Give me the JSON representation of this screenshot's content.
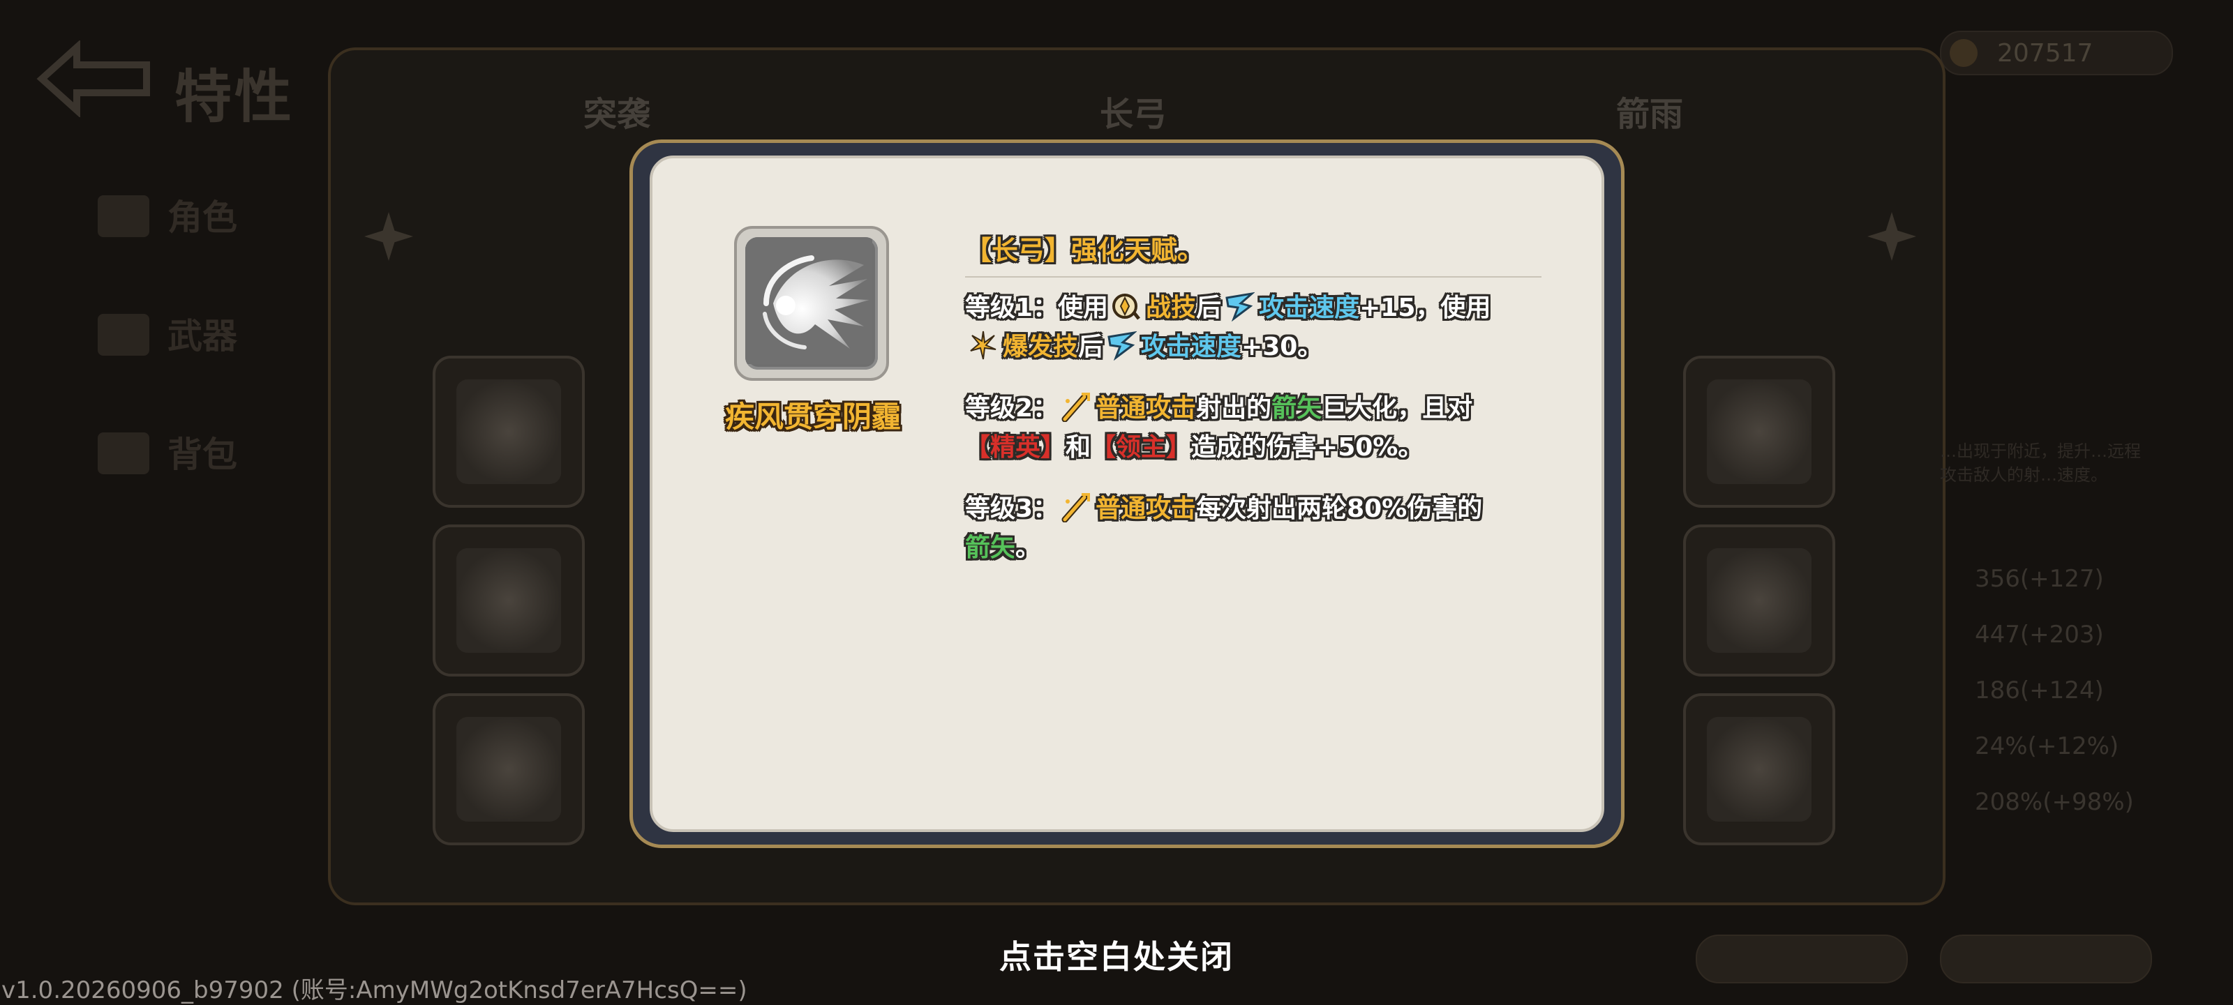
{
  "background": {
    "screen_title": "特性",
    "currency_value": "207517",
    "tabs": [
      "突袭",
      "长弓",
      "箭雨"
    ],
    "side_menu": [
      "角色",
      "武器",
      "背包"
    ],
    "stats": [
      "356(+127)",
      "447(+203)",
      "186(+124)",
      "24%(+12%)",
      "208%(+98%)"
    ],
    "right_desc": "…出现于附近，提升…远程攻击敌人的射…速度。"
  },
  "modal": {
    "skill_name": "疾风贯穿阴霾",
    "title": "【长弓】强化天赋。",
    "level1": {
      "prefix": "等级1：使用",
      "t1": "战技",
      "t2": "后",
      "t3": "攻击速度",
      "t4": "+15，使用",
      "t5": "爆发技",
      "t6": "后",
      "t7": "攻击速度",
      "t8": "+30。"
    },
    "level2": {
      "prefix": "等级2：",
      "t1": "普通攻击",
      "t2": "射出的",
      "t3": "箭矢",
      "t4": "巨大化，且对",
      "t5": "【精英】",
      "t6": "和",
      "t7": "【领主】",
      "t8": "造成的伤害+50%。"
    },
    "level3": {
      "prefix": "等级3：",
      "t1": "普通攻击",
      "t2": "每次射出两轮80%伤害的",
      "t3": "箭矢",
      "t4": "。"
    },
    "icons": {
      "skill": "wind-arrow-burst-icon",
      "battle_skill": "battle-skill-icon",
      "attack_speed": "attack-speed-icon",
      "burst_skill": "burst-skill-icon",
      "normal_attack": "normal-attack-icon"
    }
  },
  "close_hint": "点击空白处关闭",
  "version": "v1.0.20260906_b97902 (账号:AmyMWg2otKnsd7erA7HcsQ==)",
  "colors": {
    "gold": "#f2b531",
    "cyan": "#5fc8ee",
    "green": "#56c25a",
    "red": "#d8302a",
    "panel": "#ece8df"
  }
}
